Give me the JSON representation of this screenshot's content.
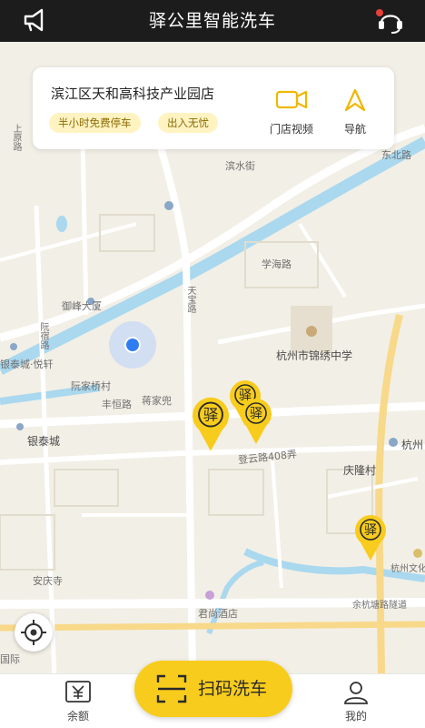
{
  "header": {
    "title": "驿公里智能洗车"
  },
  "store_card": {
    "name": "滨江区天和高科技产业园店",
    "tags": [
      "半小时免费停车",
      "出入无忧"
    ],
    "video_label": "门店视频",
    "nav_label": "导航"
  },
  "station_pin_glyph": "驿",
  "map_labels": {
    "river_street": "滨水街",
    "dongtie": "东北路",
    "xuehai": "学海路",
    "yufeng": "御峰大厦",
    "shangyuan": "上原路",
    "tianbao": "天宝路",
    "yintai_yuexuan": "银泰城·悦轩",
    "ruanjia_bridge": "阮家桥村",
    "fengjia": "丰恒路",
    "jiangjiadou": "蒋家兜",
    "ruanxiang": "阮宿路",
    "school": "杭州市锦绣中学",
    "dengyun": "登云路408弄",
    "yintai_city": "银泰城",
    "qinglong": "庆隆村",
    "hangzhou_short": "杭州",
    "hangzhou_culture": "杭州文化",
    "anqing_temple": "安庆寺",
    "junshang_hotel": "君尚酒店",
    "yuhang_tunnel": "余杭塘路隧道",
    "intl": "国际"
  },
  "bottom_nav": {
    "balance_label": "余额",
    "scan_label": "扫码洗车",
    "mine_label": "我的"
  },
  "colors": {
    "accent": "#f8cc1c",
    "header_bg": "#1c1c1c",
    "river": "#a9d8ef",
    "location_dot": "#2f7df3"
  }
}
